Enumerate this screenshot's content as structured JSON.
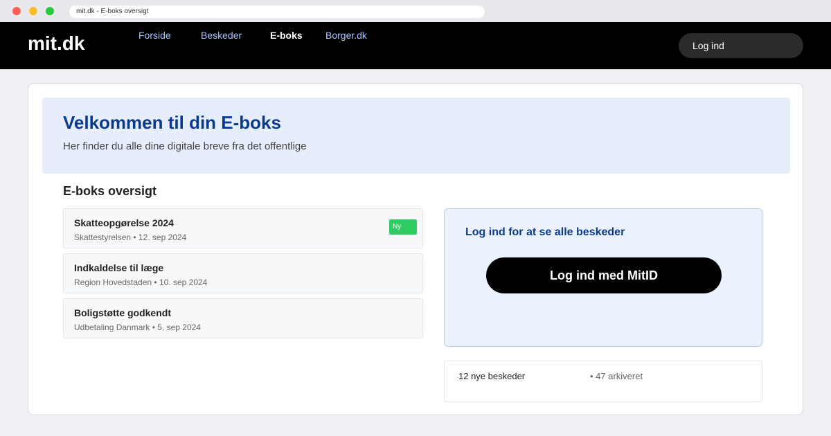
{
  "browser": {
    "url_text": "mit.dk - E-boks oversigt"
  },
  "header": {
    "logo": "mit.dk",
    "nav": [
      {
        "label": "Forside",
        "active": false
      },
      {
        "label": "Beskeder",
        "active": false
      },
      {
        "label": "E-boks",
        "active": true
      },
      {
        "label": "Borger.dk",
        "active": false
      }
    ],
    "login_label": "Log ind"
  },
  "hero": {
    "title": "Velkommen til din E-boks",
    "subtitle": "Her finder du alle dine digitale breve fra det offentlige"
  },
  "overview": {
    "title": "E-boks oversigt",
    "messages": [
      {
        "title": "Skatteopgørelse 2024",
        "sender_date": "Skattestyrelsen • 12. sep 2024",
        "badge": "Ny"
      },
      {
        "title": "Indkaldelse til læge",
        "sender_date": "Region Hovedstaden • 10. sep 2024"
      },
      {
        "title": "Boligstøtte godkendt",
        "sender_date": "Udbetaling Danmark • 5. sep 2024"
      }
    ]
  },
  "login_panel": {
    "title": "Log ind for at se alle beskeder",
    "button_label": "Log ind med MitID"
  },
  "stats": {
    "new_messages": "12 nye beskeder",
    "archived": "• 47 arkiveret"
  },
  "colors": {
    "header_bg": "#000000",
    "nav_link": "#a9c4ff",
    "hero_bg": "#e6eefc",
    "title_blue": "#0a3a8c",
    "badge_green": "#2ecc62"
  }
}
